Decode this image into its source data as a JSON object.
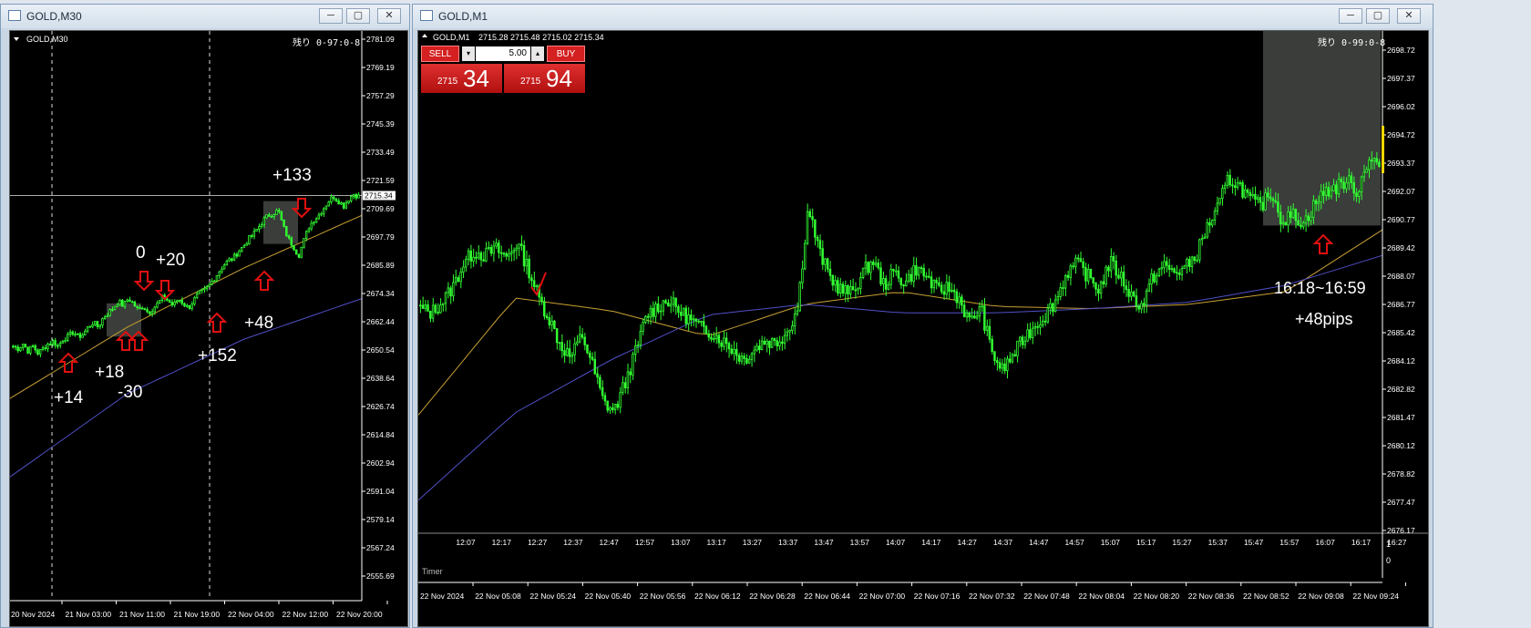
{
  "left_window": {
    "title": "GOLD,M30",
    "chart_label": "GOLD,M30",
    "countdown": "残り 0-97:0-8",
    "buttons": {
      "minimize": "─",
      "maximize": "▢",
      "close": "✕"
    }
  },
  "right_window": {
    "title": "GOLD,M1",
    "chart_label": "GOLD,M1",
    "quote": "2715.28 2715.48 2715.02 2715.34",
    "countdown": "残り 0-99:0-8",
    "timer_label": "Timer",
    "buttons": {
      "minimize": "─",
      "maximize": "▢",
      "close": "✕"
    },
    "trade_panel": {
      "sell_label": "SELL",
      "buy_label": "BUY",
      "lot_value": "5.00",
      "sell_price_small": "2715",
      "sell_price_big": "34",
      "buy_price_small": "2715",
      "buy_price_big": "94"
    },
    "sub_axis": [
      "1",
      "0"
    ]
  },
  "colors": {
    "background": "#000000",
    "candle": "#32ff32",
    "ma_fast": "#c8a032",
    "ma_slow": "#5050c8",
    "arrow": "#e01010",
    "annotation_text": "#ffffff",
    "sell_bg": "#d42020",
    "buy_bg": "#d42020",
    "price_marker": "#ffd700"
  },
  "chart_data": [
    {
      "type": "candlestick",
      "symbol": "GOLD",
      "timeframe": "M30",
      "y_ticks": [
        "2781.09",
        "2769.19",
        "2757.29",
        "2745.39",
        "2733.49",
        "2721.59",
        "2709.69",
        "2697.79",
        "2685.89",
        "2674.34",
        "2662.44",
        "2650.54",
        "2638.64",
        "2626.74",
        "2614.84",
        "2602.94",
        "2591.04",
        "2579.14",
        "2567.24",
        "2555.69"
      ],
      "ylim": [
        2555.69,
        2781.09
      ],
      "x_ticks": [
        "20 Nov 2024",
        "21 Nov 03:00",
        "21 Nov 11:00",
        "21 Nov 19:00",
        "22 Nov 04:00",
        "22 Nov 12:00",
        "22 Nov 20:00"
      ],
      "current_price": "2715.34",
      "price_path": [
        2652,
        2651,
        2653,
        2650,
        2652,
        2649,
        2651,
        2653,
        2654,
        2652,
        2655,
        2656,
        2658,
        2656,
        2657,
        2660,
        2662,
        2660,
        2664,
        2666,
        2668,
        2671,
        2669,
        2672,
        2670,
        2667,
        2669,
        2666,
        2668,
        2670,
        2673,
        2671,
        2669,
        2672,
        2670,
        2668,
        2671,
        2674,
        2675,
        2677,
        2680,
        2683,
        2686,
        2688,
        2689,
        2692,
        2694,
        2697,
        2699,
        2702,
        2705,
        2707,
        2708,
        2709,
        2702,
        2697,
        2694,
        2690,
        2696,
        2702,
        2705,
        2707,
        2710,
        2713,
        2715,
        2713,
        2711,
        2714,
        2716,
        2715
      ],
      "ma_fast": [
        2630,
        2660,
        2685,
        2707
      ],
      "ma_slow": [
        2597,
        2632,
        2655,
        2672
      ],
      "annotations": [
        "+14",
        "+18",
        "-30",
        "0",
        "+20",
        "+152",
        "+48",
        "+133"
      ]
    },
    {
      "type": "candlestick",
      "symbol": "GOLD",
      "timeframe": "M1",
      "y_ticks": [
        "2698.72",
        "2697.37",
        "2696.02",
        "2694.72",
        "2693.37",
        "2692.07",
        "2690.77",
        "2689.42",
        "2688.07",
        "2686.77",
        "2685.42",
        "2684.12",
        "2682.82",
        "2681.47",
        "2680.12",
        "2678.82",
        "2677.47",
        "2676.17"
      ],
      "ylim": [
        2676.17,
        2698.72
      ],
      "x_ticks_top": [
        "12:07",
        "12:17",
        "12:27",
        "12:37",
        "12:47",
        "12:57",
        "13:07",
        "13:17",
        "13:27",
        "13:37",
        "13:47",
        "13:57",
        "14:07",
        "14:17",
        "14:27",
        "14:37",
        "14:47",
        "14:57",
        "15:07",
        "15:17",
        "15:27",
        "15:37",
        "15:47",
        "15:57",
        "16:07",
        "16:17",
        "16:27"
      ],
      "x_ticks_bottom": [
        "22 Nov 2024",
        "22 Nov 05:08",
        "22 Nov 05:24",
        "22 Nov 05:40",
        "22 Nov 05:56",
        "22 Nov 06:12",
        "22 Nov 06:28",
        "22 Nov 06:44",
        "22 Nov 07:00",
        "22 Nov 07:16",
        "22 Nov 07:32",
        "22 Nov 07:48",
        "22 Nov 08:04",
        "22 Nov 08:20",
        "22 Nov 08:36",
        "22 Nov 08:52",
        "22 Nov 09:08",
        "22 Nov 09:24"
      ],
      "price_path": [
        2686.5,
        2686.3,
        2686.8,
        2687.5,
        2688.6,
        2689.2,
        2689.0,
        2689.3,
        2688.9,
        2689.6,
        2688.4,
        2687.0,
        2686.0,
        2684.8,
        2684.2,
        2685.3,
        2683.8,
        2682.1,
        2681.7,
        2683.0,
        2684.5,
        2686.2,
        2686.6,
        2686.9,
        2686.4,
        2686.0,
        2685.6,
        2685.4,
        2685.0,
        2684.6,
        2684.1,
        2684.6,
        2685.0,
        2684.9,
        2685.4,
        2686.5,
        2691.3,
        2689.2,
        2688.0,
        2687.4,
        2687.2,
        2688.1,
        2688.8,
        2687.6,
        2688.2,
        2687.7,
        2688.4,
        2688.0,
        2687.3,
        2687.5,
        2687.0,
        2685.8,
        2686.6,
        2684.5,
        2683.6,
        2684.3,
        2685.1,
        2685.7,
        2686.2,
        2686.9,
        2688.2,
        2688.6,
        2688.0,
        2687.4,
        2688.7,
        2688.0,
        2687.1,
        2686.6,
        2688.0,
        2688.5,
        2688.2,
        2688.4,
        2689.0,
        2690.3,
        2691.2,
        2692.6,
        2692.3,
        2691.6,
        2691.3,
        2692.0,
        2690.6,
        2690.9,
        2690.5,
        2691.4,
        2692.0,
        2692.2,
        2692.5,
        2692.0,
        2693.6,
        2693.2
      ],
      "ma_fast": [
        2681.5,
        2687.0,
        2686.4,
        2685.2,
        2686.7,
        2687.3,
        2686.6,
        2686.5,
        2686.7,
        2687.3,
        2690.2
      ],
      "ma_slow": [
        2677.5,
        2681.6,
        2684.1,
        2686.2,
        2686.7,
        2686.3,
        2686.3,
        2686.5,
        2686.8,
        2687.6,
        2689.0
      ],
      "highlight_note": [
        "16:18~16:59",
        "+48pips"
      ],
      "annotations": [
        "16:18~16:59",
        "+48pips"
      ]
    }
  ]
}
